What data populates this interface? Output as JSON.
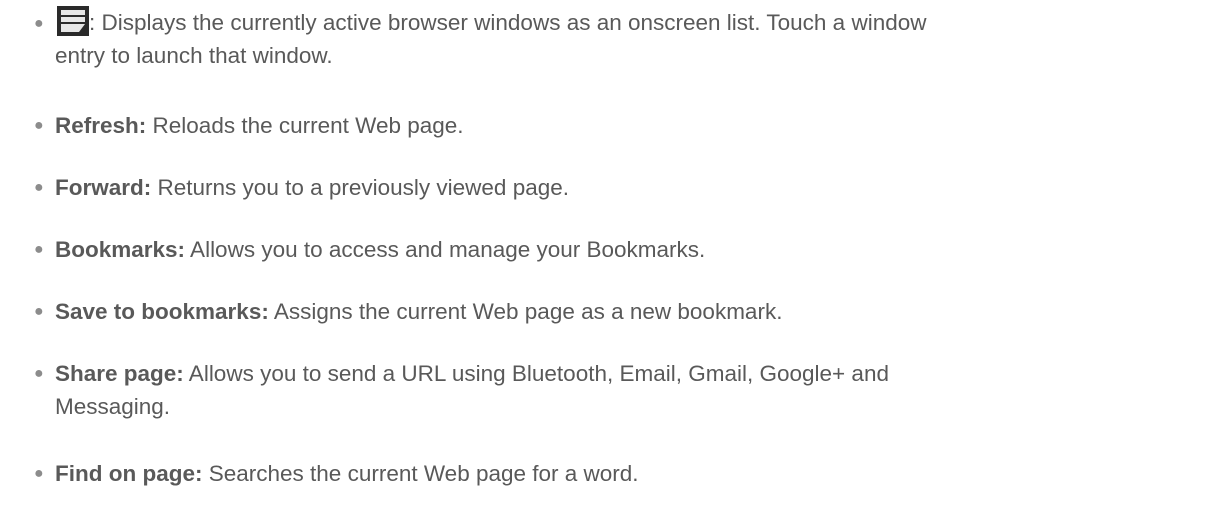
{
  "items": [
    {
      "icon": "browser-windows-icon",
      "term": "",
      "sep": ":",
      "desc_line1": " Displays the currently active browser windows as an onscreen list. Touch a window",
      "desc_line2": "entry to launch that window."
    },
    {
      "term": "Refresh:",
      "desc": " Reloads the current Web page."
    },
    {
      "term": "Forward:",
      "desc": " Returns you to a previously viewed page."
    },
    {
      "term": "Bookmarks:",
      "desc": " Allows you to access and manage your Bookmarks."
    },
    {
      "term": "Save to bookmarks:",
      "desc": " Assigns the current Web page as a new bookmark."
    },
    {
      "term": "Share page:",
      "desc_line1": " Allows you to send a URL using Bluetooth, Email, Gmail, Google+ and",
      "desc_line2": "Messaging."
    },
    {
      "term": "Find on page:",
      "desc": " Searches the current Web page for a word."
    }
  ],
  "bullet_glyph": "●",
  "colors": {
    "text": "#595959",
    "bullet": "#8c8c8c"
  }
}
